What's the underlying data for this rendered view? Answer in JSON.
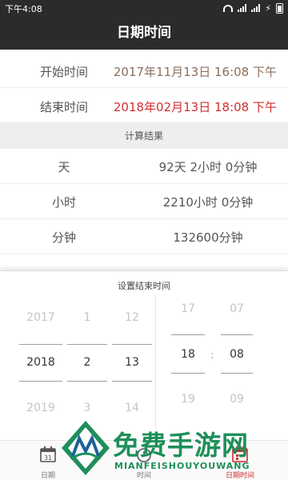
{
  "statusbar": {
    "time": "下午4:08"
  },
  "titlebar": {
    "title": "日期时间"
  },
  "range": {
    "start_label": "开始时间",
    "start_value": "2017年11月13日 16:08 下午",
    "end_label": "结束时间",
    "end_value": "2018年02月13日 18:08 下午"
  },
  "section": {
    "title": "计算结果"
  },
  "results": {
    "day_label": "天",
    "day_value": "92天 2小时 0分钟",
    "hour_label": "小时",
    "hour_value": "2210小时 0分钟",
    "minute_label": "分钟",
    "minute_value": "132600分钟"
  },
  "picker": {
    "title": "设置结束时间",
    "year": {
      "prev": "2017",
      "selected": "2018",
      "next": "2019"
    },
    "month": {
      "prev": "1",
      "selected": "2",
      "next": "3"
    },
    "day": {
      "prev": "12",
      "selected": "13",
      "next": "14"
    },
    "hour": {
      "prev": "17",
      "selected": "18",
      "next": "19"
    },
    "minute": {
      "prev": "07",
      "selected": "08",
      "next": "09"
    },
    "separator": ":"
  },
  "bottomnav": {
    "date_label": "日期",
    "date_icon_number": "31",
    "time_label": "时间",
    "datetime_label": "日期时间",
    "active_color": "#d22e2e"
  },
  "watermark": {
    "title": "免费手游网",
    "subtitle": "MIANFEISHOUYOUWANG",
    "color": "#1e8f5a"
  },
  "colors": {
    "bar": "#2b2b2b",
    "start_value": "#8b6e5c",
    "end_value": "#d22e2e"
  }
}
